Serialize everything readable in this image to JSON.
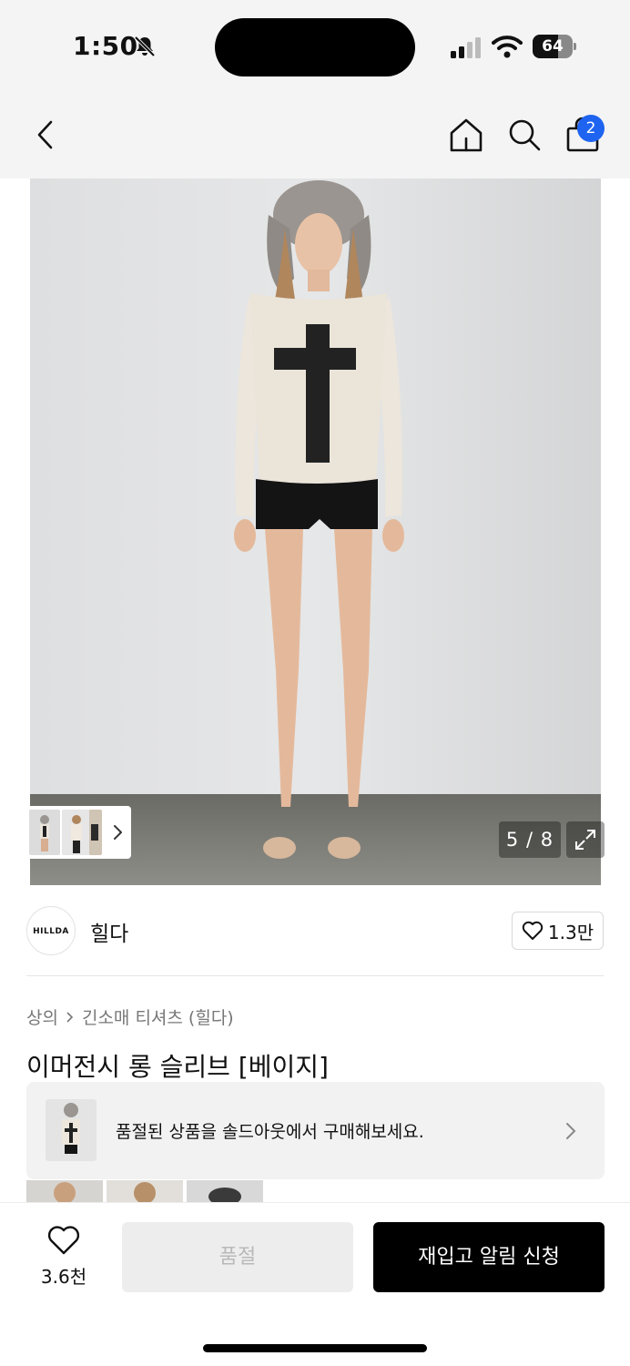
{
  "status_bar": {
    "time": "1:50",
    "battery_level": "64",
    "battery_fraction": 0.64
  },
  "nav": {
    "back_icon": "chevron-left",
    "home_icon": "home",
    "search_icon": "search",
    "cart_icon": "shopping-bag",
    "cart_badge": "2"
  },
  "gallery": {
    "counter": "5 / 8",
    "expand_icon": "expand-arrows"
  },
  "brand": {
    "logo_text": "HILLDA",
    "name": "힐다",
    "likes": "1.3만"
  },
  "product": {
    "breadcrumb": [
      "상의",
      "긴소매 티셔츠 (힐다)"
    ],
    "title": "이머전시 롱 슬리브 [베이지]"
  },
  "soldout_banner": {
    "text": "품절된 상품을 솔드아웃에서 구매해보세요."
  },
  "bottom_bar": {
    "wish_count": "3.6천",
    "soldout_label": "품절",
    "restock_label": "재입고 알림 신청"
  },
  "colors": {
    "badge_blue": "#1f64f0",
    "primary_button": "#000000",
    "disabled_button": "#ededed",
    "header_bg": "#f4f4f4"
  }
}
